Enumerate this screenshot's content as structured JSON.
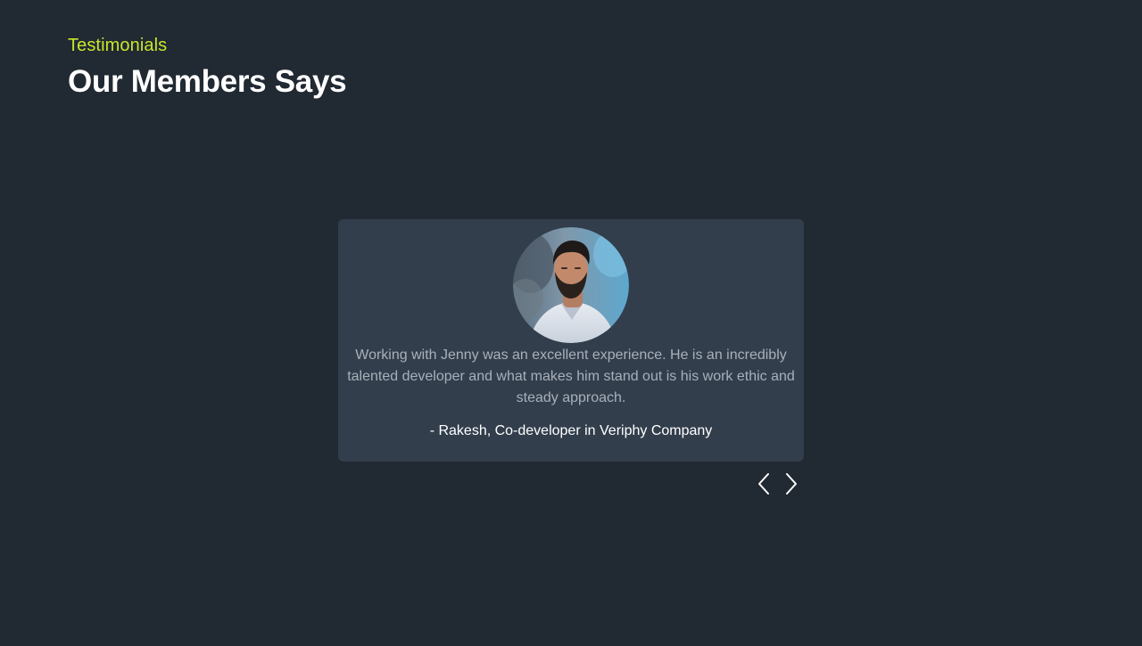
{
  "section": {
    "eyebrow": "Testimonials",
    "title": "Our Members Says"
  },
  "testimonial": {
    "quote": "Working with Jenny was an excellent experience. He is an incredibly talented developer and what makes him stand out is his work ethic and steady approach.",
    "author": "- Rakesh, Co-developer in Veriphy Company",
    "avatar_icon": "person-portrait"
  },
  "controls": {
    "prev_icon": "chevron-left-icon",
    "next_icon": "chevron-right-icon"
  },
  "colors": {
    "background": "#212933",
    "card": "#323e4c",
    "accent": "#c7e62a",
    "text_muted": "#a8b0ba",
    "text": "#ffffff"
  }
}
